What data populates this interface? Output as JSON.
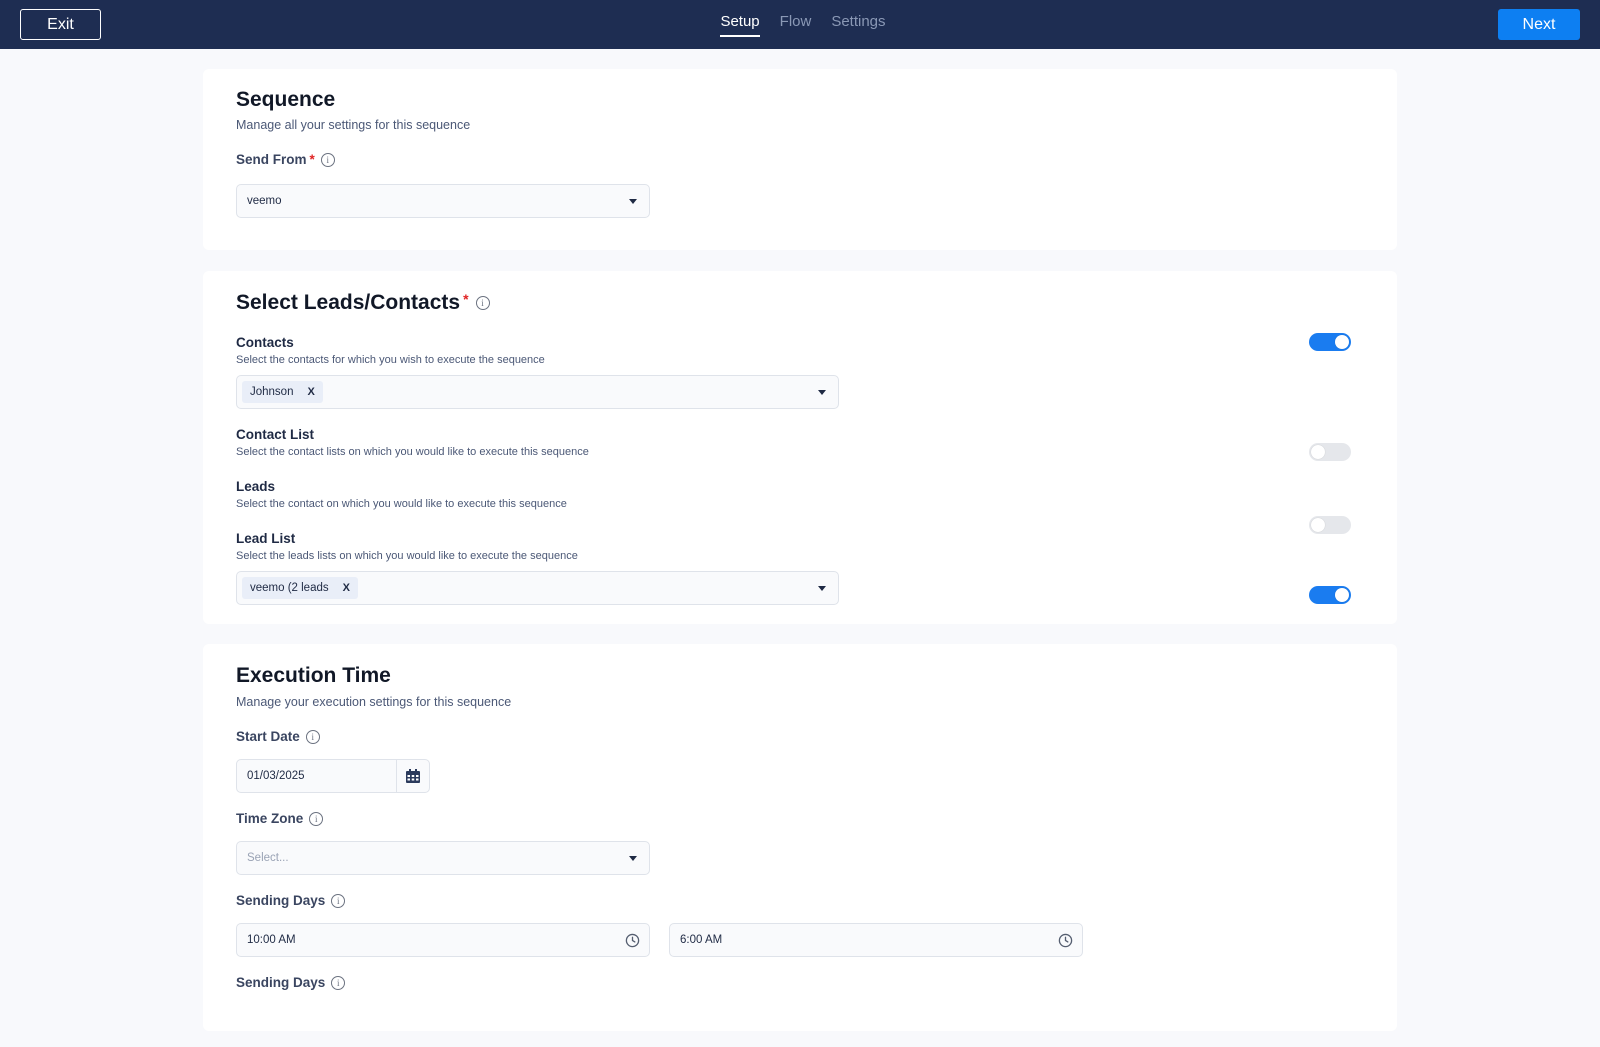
{
  "header": {
    "exit_label": "Exit",
    "tabs": [
      {
        "label": "Setup",
        "active": true
      },
      {
        "label": "Flow",
        "active": false
      },
      {
        "label": "Settings",
        "active": false
      }
    ],
    "next_label": "Next"
  },
  "sequence": {
    "title": "Sequence",
    "subtitle": "Manage all your settings for this sequence",
    "send_from_label": "Send From",
    "required_mark": "*",
    "send_from_value": "veemo"
  },
  "leads": {
    "title": "Select Leads/Contacts",
    "required_mark": "*",
    "sections": [
      {
        "label": "Contacts",
        "description": "Select the contacts for which you wish to execute the sequence",
        "enabled": true,
        "chip": "Johnson"
      },
      {
        "label": "Contact List",
        "description": "Select the contact lists on which you would like to execute this sequence",
        "enabled": false
      },
      {
        "label": "Leads",
        "description": "Select the contact on which you would like to execute this sequence",
        "enabled": false
      },
      {
        "label": "Lead List",
        "description": "Select the leads lists on which you would like to execute the sequence",
        "enabled": true,
        "chip": "veemo (2 leads"
      }
    ],
    "chip_remove": "X"
  },
  "execution": {
    "title": "Execution Time",
    "subtitle": "Manage your execution settings for this sequence",
    "start_date_label": "Start Date",
    "start_date_value": "01/03/2025",
    "timezone_label": "Time Zone",
    "timezone_placeholder": "Select...",
    "sending_days_label": "Sending Days",
    "start_time": "10:00 AM",
    "end_time": "6:00 AM",
    "sending_days_label_2": "Sending Days"
  },
  "colors": {
    "header_bg": "#1e2d52",
    "primary": "#0d7ff2",
    "toggle_on": "#1a7cf0",
    "required": "#e02424"
  },
  "icons": [
    "info-icon",
    "chevron-down-icon",
    "calendar-icon",
    "clock-icon",
    "close-icon"
  ]
}
